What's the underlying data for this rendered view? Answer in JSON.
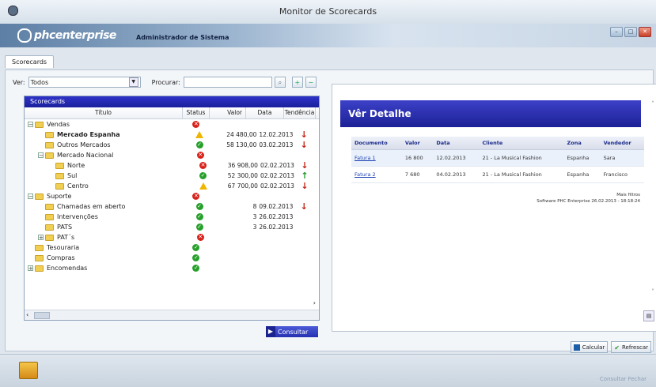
{
  "window": {
    "title": "Monitor de Scorecards"
  },
  "header": {
    "logo_text": "phcenterprise",
    "user": "Administrador de Sistema"
  },
  "tabs": [
    "Scorecards"
  ],
  "filters": {
    "ver_label": "Ver:",
    "ver_value": "Todos",
    "procurar_label": "Procurar:",
    "procurar_value": ""
  },
  "scorecards": {
    "header": "Scorecards",
    "columns": {
      "title": "Título",
      "status": "Status",
      "valor": "Valor",
      "data": "Data",
      "tendencia": "Tendência"
    },
    "rows": [
      {
        "label": "Vendas",
        "level": 0,
        "expander": "-",
        "status": "red",
        "valor": "",
        "data": "",
        "trend": ""
      },
      {
        "label": "Mercado Espanha",
        "level": 1,
        "expander": "",
        "status": "warn",
        "valor": "24 480,00",
        "data": "12.02.2013",
        "trend": "down",
        "selected": true
      },
      {
        "label": "Outros Mercados",
        "level": 1,
        "expander": "",
        "status": "green",
        "valor": "58 130,00",
        "data": "03.02.2013",
        "trend": "down"
      },
      {
        "label": "Mercado Nacional",
        "level": 1,
        "expander": "-",
        "status": "red",
        "valor": "",
        "data": "",
        "trend": ""
      },
      {
        "label": "Norte",
        "level": 2,
        "expander": "",
        "status": "red",
        "valor": "36 908,00",
        "data": "02.02.2013",
        "trend": "down"
      },
      {
        "label": "Sul",
        "level": 2,
        "expander": "",
        "status": "green",
        "valor": "52 300,00",
        "data": "02.02.2013",
        "trend": "up"
      },
      {
        "label": "Centro",
        "level": 2,
        "expander": "",
        "status": "warn",
        "valor": "67 700,00",
        "data": "02.02.2013",
        "trend": "down"
      },
      {
        "label": "Suporte",
        "level": 0,
        "expander": "-",
        "status": "red",
        "valor": "",
        "data": "",
        "trend": ""
      },
      {
        "label": "Chamadas em aberto",
        "level": 1,
        "expander": "",
        "status": "green",
        "valor": "8",
        "data": "09.02.2013",
        "trend": "down"
      },
      {
        "label": "Intervenções",
        "level": 1,
        "expander": "",
        "status": "green",
        "valor": "3",
        "data": "26.02.2013",
        "trend": ""
      },
      {
        "label": "PATS",
        "level": 1,
        "expander": "",
        "status": "green",
        "valor": "3",
        "data": "26.02.2013",
        "trend": ""
      },
      {
        "label": "PAT´s",
        "level": 1,
        "expander": "+",
        "status": "red",
        "valor": "",
        "data": "",
        "trend": ""
      },
      {
        "label": "Tesouraria",
        "level": 0,
        "expander": "",
        "status": "green",
        "valor": "",
        "data": "",
        "trend": ""
      },
      {
        "label": "Compras",
        "level": 0,
        "expander": "",
        "status": "green",
        "valor": "",
        "data": "",
        "trend": ""
      },
      {
        "label": "Encomendas",
        "level": 0,
        "expander": "+",
        "status": "green",
        "valor": "",
        "data": "",
        "trend": ""
      }
    ]
  },
  "consultar": {
    "label": "Consultar"
  },
  "details": {
    "title": "Vêr Detalhe",
    "columns": [
      "Documento",
      "Valor",
      "Data",
      "Cliente",
      "Zona",
      "Vendedor"
    ],
    "rows": [
      [
        "Fatura 1",
        "16 800",
        "12.02.2013",
        "21 - La Musical Fashion",
        "Espanha",
        "Sara"
      ],
      [
        "Fatura 2",
        "7 680",
        "04.02.2013",
        "21 - La Musical Fashion",
        "Espanha",
        "Francisco"
      ]
    ],
    "footnote_line1": "Mais filtros",
    "footnote_line2": "Software PHC Enterprise 26.02.2013 - 18:18:24"
  },
  "buttons": {
    "calcular": "Calcular",
    "refrescar": "Refrescar"
  },
  "status_right": "Consultar   Fechar"
}
